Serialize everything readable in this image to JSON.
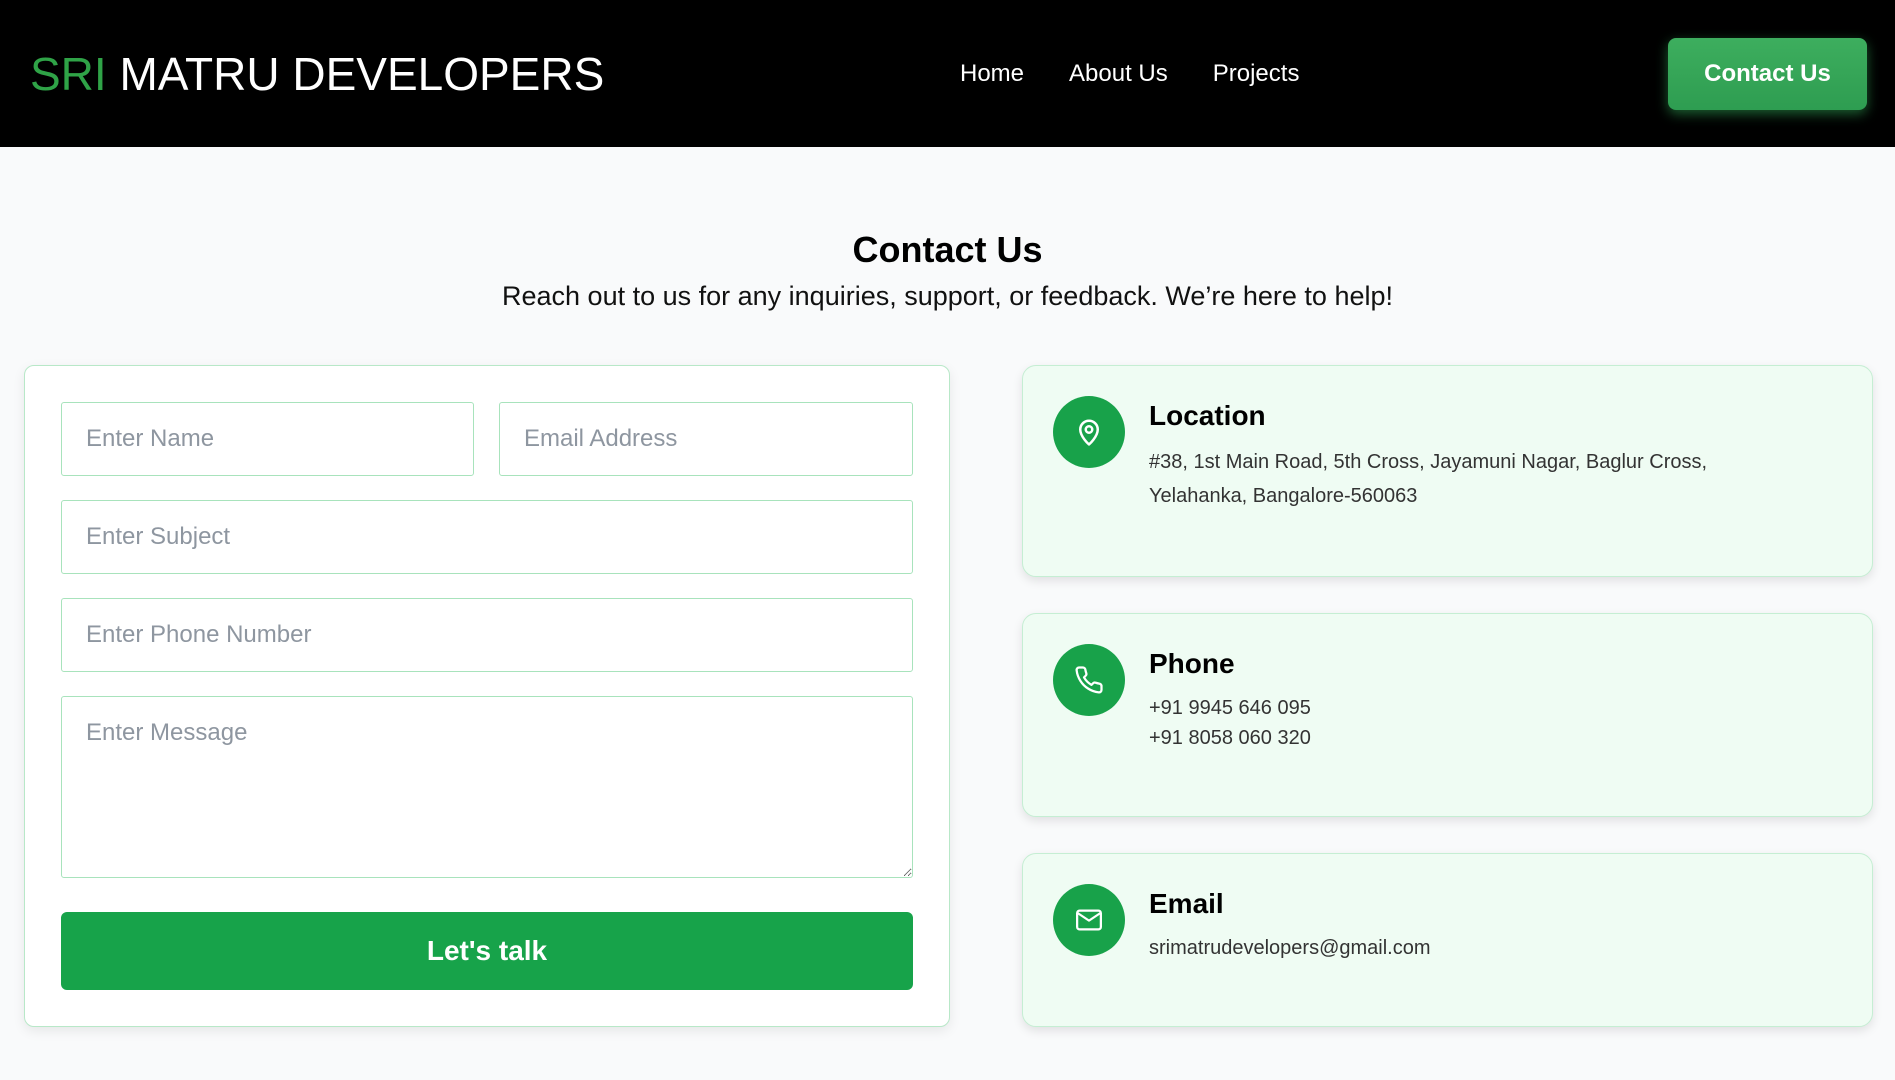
{
  "header": {
    "logo_accent": "SRI",
    "logo_text": "MATRU DEVELOPERS",
    "nav": [
      "Home",
      "About Us",
      "Projects"
    ],
    "cta_label": "Contact Us"
  },
  "intro": {
    "title": "Contact Us",
    "subtitle": "Reach out to us for any inquiries, support, or feedback. We’re here to help!"
  },
  "form": {
    "name_placeholder": "Enter Name",
    "email_placeholder": "Email Address",
    "subject_placeholder": "Enter Subject",
    "phone_placeholder": "Enter Phone Number",
    "message_placeholder": "Enter Message",
    "submit_label": "Let's talk"
  },
  "info": {
    "location": {
      "title": "Location",
      "icon": "map-pin-icon",
      "line1": "#38, 1st Main Road, 5th Cross, Jayamuni Nagar, Baglur Cross,",
      "line2": "Yelahanka, Bangalore-560063"
    },
    "phone": {
      "title": "Phone",
      "icon": "phone-icon",
      "line1": "+91 9945 646 095",
      "line2": "+91 8058 060 320"
    },
    "email": {
      "title": "Email",
      "icon": "mail-icon",
      "line1": "srimatrudevelopers@gmail.com"
    }
  },
  "colors": {
    "brand_green": "#17a34a",
    "header_bg": "#000000",
    "card_bg": "#effcf3",
    "page_bg": "#f9fafb"
  }
}
